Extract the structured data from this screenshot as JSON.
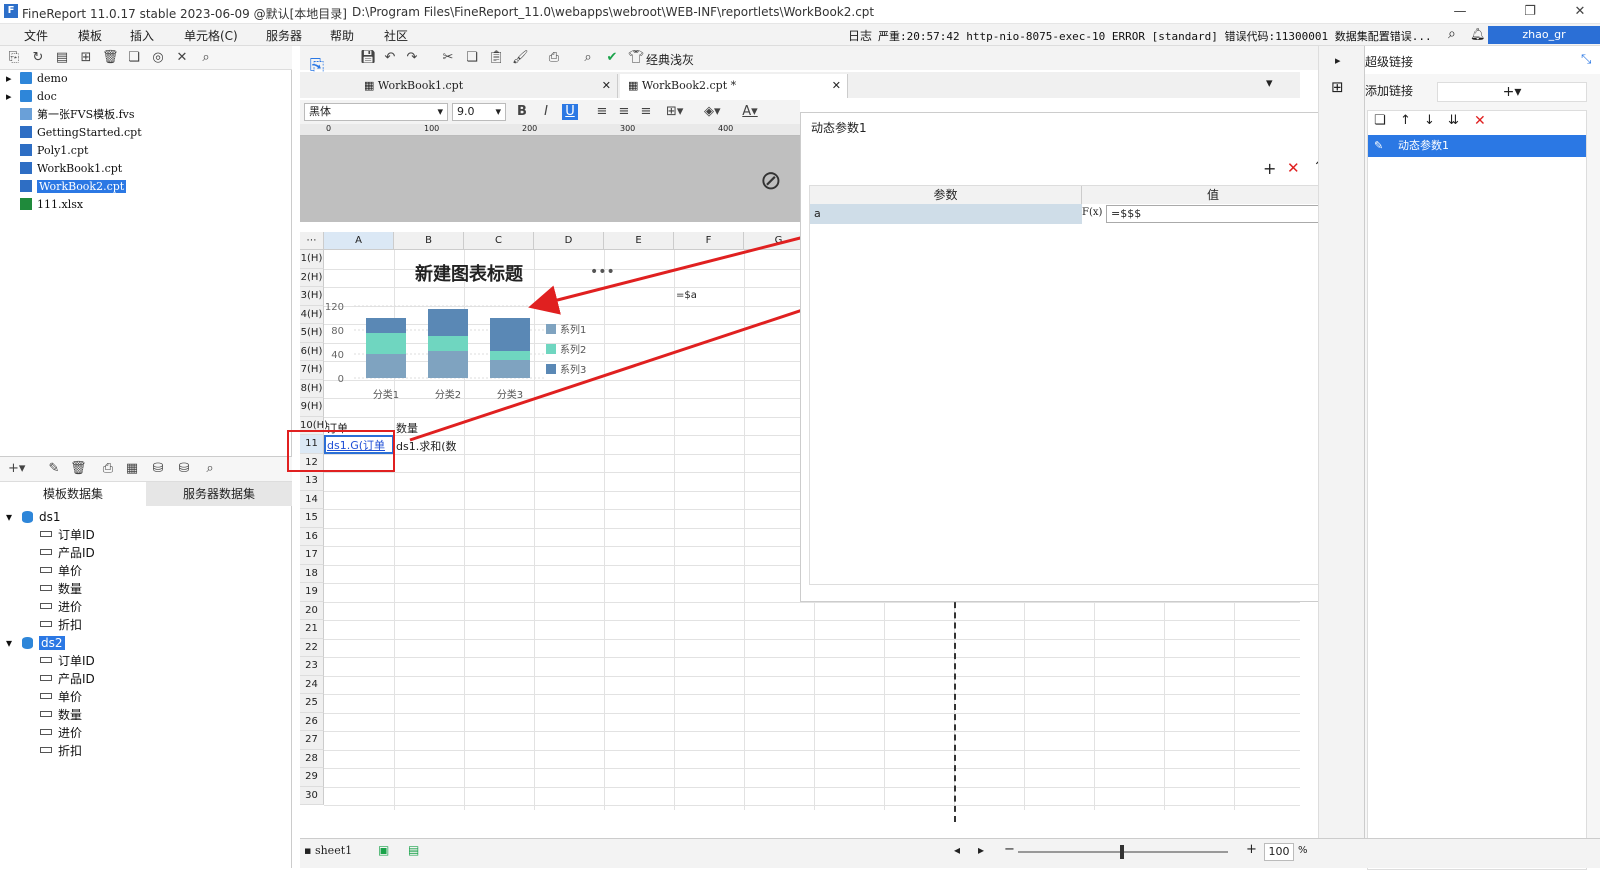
{
  "window": {
    "title": "FineReport 11.0.17 stable 2023-06-09 @默认[本地目录]",
    "path": "D:\\Program Files\\FineReport_11.0\\webapps\\webroot\\WEB-INF\\reportlets\\WorkBook2.cpt"
  },
  "menu": [
    "文件",
    "模板",
    "插入",
    "单元格(C)",
    "服务器",
    "帮助",
    "社区"
  ],
  "log": {
    "label": "日志",
    "text": "严重:20:57:42 http-nio-8075-exec-10 ERROR [standard] 错误代码:11300001 数据集配置错误..."
  },
  "user": "zhao_gr",
  "file_tree": [
    {
      "name": "demo",
      "type": "folder"
    },
    {
      "name": "doc",
      "type": "folder"
    },
    {
      "name": "第一张FVS模板.fvs",
      "type": "fvs"
    },
    {
      "name": "GettingStarted.cpt",
      "type": "cpt"
    },
    {
      "name": "Poly1.cpt",
      "type": "cpt"
    },
    {
      "name": "WorkBook1.cpt",
      "type": "cpt"
    },
    {
      "name": "WorkBook2.cpt",
      "type": "cpt",
      "selected": true
    },
    {
      "name": "111.xlsx",
      "type": "xlsx"
    }
  ],
  "dataset_tabs": [
    "模板数据集",
    "服务器数据集"
  ],
  "datasets": [
    {
      "name": "ds1",
      "fields": [
        "订单ID",
        "产品ID",
        "单价",
        "数量",
        "进价",
        "折扣"
      ]
    },
    {
      "name": "ds2",
      "fields": [
        "订单ID",
        "产品ID",
        "单价",
        "数量",
        "进价",
        "折扣"
      ]
    }
  ],
  "toolbar": {
    "theme_label": "经典浅灰"
  },
  "doc_tabs": [
    "WorkBook1.cpt",
    "WorkBook2.cpt *"
  ],
  "format": {
    "font": "黑体",
    "size": "9.0"
  },
  "ruler": [
    "0",
    "100",
    "200",
    "300",
    "400"
  ],
  "columns": [
    "A",
    "B",
    "C",
    "D",
    "E",
    "F",
    "G"
  ],
  "rows": [
    "1(H)",
    "2(H)",
    "3(H)",
    "4(H)",
    "5(H)",
    "6(H)",
    "7(H)",
    "8(H)",
    "9(H)",
    "10(H)",
    "11",
    "12",
    "13",
    "14",
    "15",
    "16",
    "17",
    "18",
    "19",
    "20",
    "21",
    "22",
    "23",
    "24",
    "25",
    "26",
    "27",
    "28",
    "29",
    "30"
  ],
  "cells": {
    "f3": "=$a",
    "a10": "订单",
    "b10": "数量",
    "a11": "ds1.G(订单",
    "b11": "ds1.求和(数"
  },
  "chart_data": {
    "type": "bar",
    "stacked": true,
    "title": "新建图表标题",
    "categories": [
      "分类1",
      "分类2",
      "分类3"
    ],
    "series": [
      {
        "name": "系列1",
        "values": [
          40,
          45,
          30
        ],
        "color": "#7fa3c0"
      },
      {
        "name": "系列2",
        "values": [
          35,
          25,
          15
        ],
        "color": "#6fd6c0"
      },
      {
        "name": "系列3",
        "values": [
          25,
          45,
          55
        ],
        "color": "#5a88b5"
      }
    ],
    "yticks": [
      "0",
      "40",
      "80",
      "120"
    ],
    "ylim": [
      0,
      120
    ],
    "legend": "right"
  },
  "popup": {
    "title": "动态参数1",
    "col_param": "参数",
    "col_value": "值",
    "row_param": "a",
    "row_value": "=$$$",
    "fx": "F(x)"
  },
  "right_panel": {
    "title": "超级链接",
    "add_label": "添加链接",
    "link_item": "动态参数1"
  },
  "status": {
    "sheet": "sheet1",
    "zoom": "100",
    "pct": "%"
  }
}
